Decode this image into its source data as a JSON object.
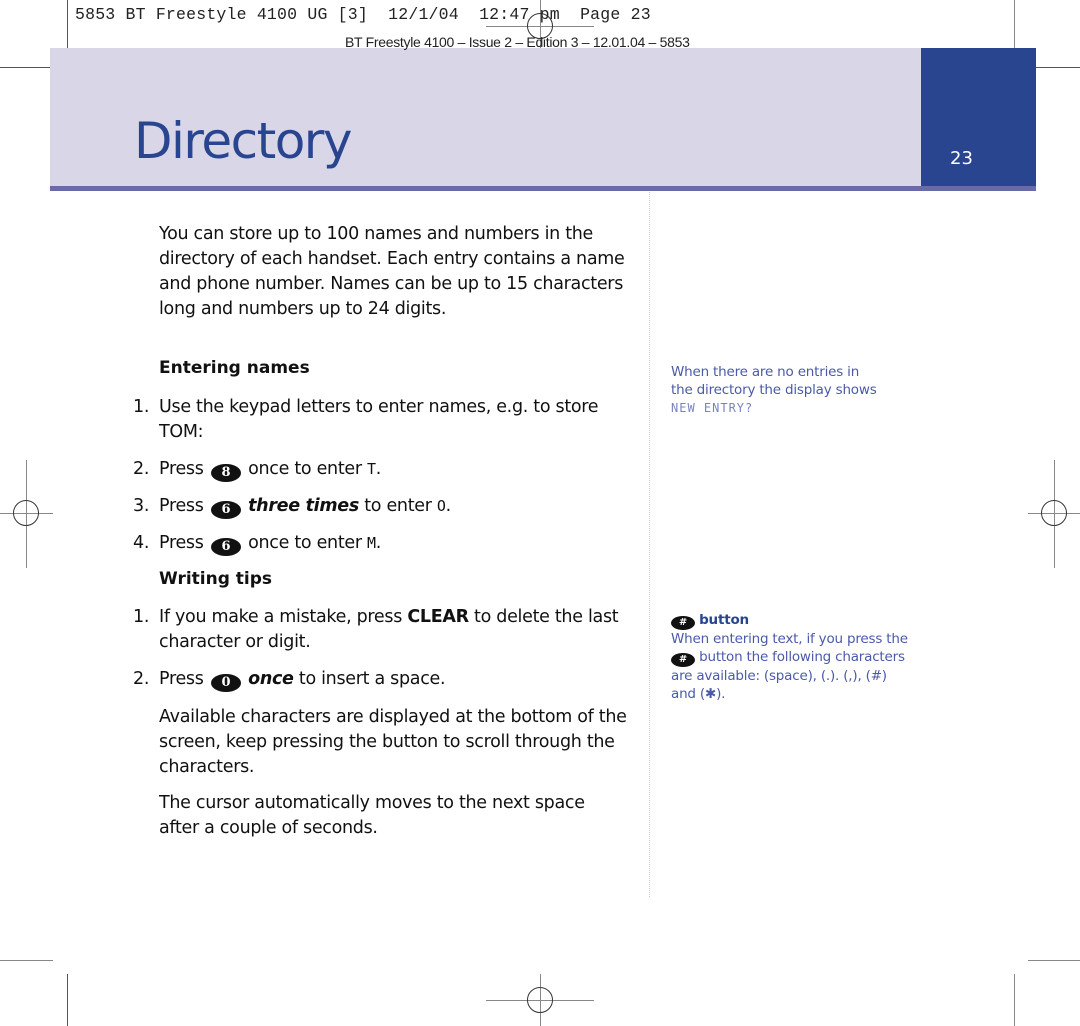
{
  "slug": {
    "job_line": "5853 BT Freestyle 4100 UG [3]  12/1/04  12:47 pm  Page 23",
    "edition_line": "BT Freestyle 4100 – Issue 2 – Edition 3 – 12.01.04 – 5853"
  },
  "header": {
    "title": "Directory",
    "page_number": "23",
    "colors": {
      "band": "#d9d6e8",
      "tab": "#2a4590",
      "rule": "#6a6aa8",
      "title": "#2a4590"
    }
  },
  "main": {
    "intro": "You can store up to 100 names and numbers in the directory of each handset. Each entry contains a name and phone number. Names can be up to 15 characters long and numbers up to 24 digits.",
    "entering_names": {
      "heading": "Entering names",
      "steps": [
        {
          "num": "1.",
          "text": "Use the keypad letters to enter names, e.g. to store TOM:"
        },
        {
          "num": "2.",
          "pre": "Press",
          "key": "8",
          "emph": "",
          "post": "once to enter",
          "char": "T",
          "end": "."
        },
        {
          "num": "3.",
          "pre": "Press",
          "key": "6",
          "emph": "three times",
          "post": "to enter",
          "char": "O",
          "end": "."
        },
        {
          "num": "4.",
          "pre": "Press",
          "key": "6",
          "emph": "",
          "post": "once to enter",
          "char": "M",
          "end": "."
        }
      ]
    },
    "writing_tips": {
      "heading": "Writing tips",
      "steps": [
        {
          "num": "1.",
          "pre": "If you make a mistake, press",
          "strong": "CLEAR",
          "post": "to delete the last character or digit."
        },
        {
          "num": "2.",
          "pre": "Press",
          "key": "0",
          "emph": "once",
          "post": "to insert a space."
        }
      ],
      "para1": "Available characters are displayed at the bottom of the screen, keep pressing the button to scroll through the characters.",
      "para2": "The cursor automatically moves to the next space after a couple of seconds."
    }
  },
  "sidebar": {
    "note1": {
      "text": "When there are no entries in the directory the display shows",
      "display": "NEW ENTRY?"
    },
    "note2": {
      "key": "#",
      "title": "button",
      "line1": "When entering text, if you press the",
      "line2": "button the following characters are available: (space), (.). (,), (#) and (✱)."
    }
  }
}
